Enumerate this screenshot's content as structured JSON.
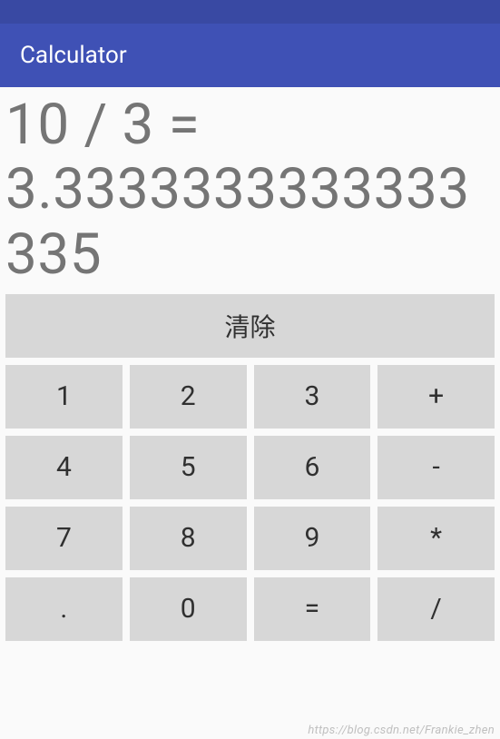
{
  "app": {
    "title": "Calculator"
  },
  "display": {
    "text": "10 / 3 = 3.3333333333333335"
  },
  "keypad": {
    "clear_label": "清除",
    "buttons": [
      "1",
      "2",
      "3",
      "+",
      "4",
      "5",
      "6",
      "-",
      "7",
      "8",
      "9",
      "*",
      ".",
      "0",
      "=",
      "/"
    ]
  },
  "watermark": "https://blog.csdn.net/Frankie_zhen"
}
